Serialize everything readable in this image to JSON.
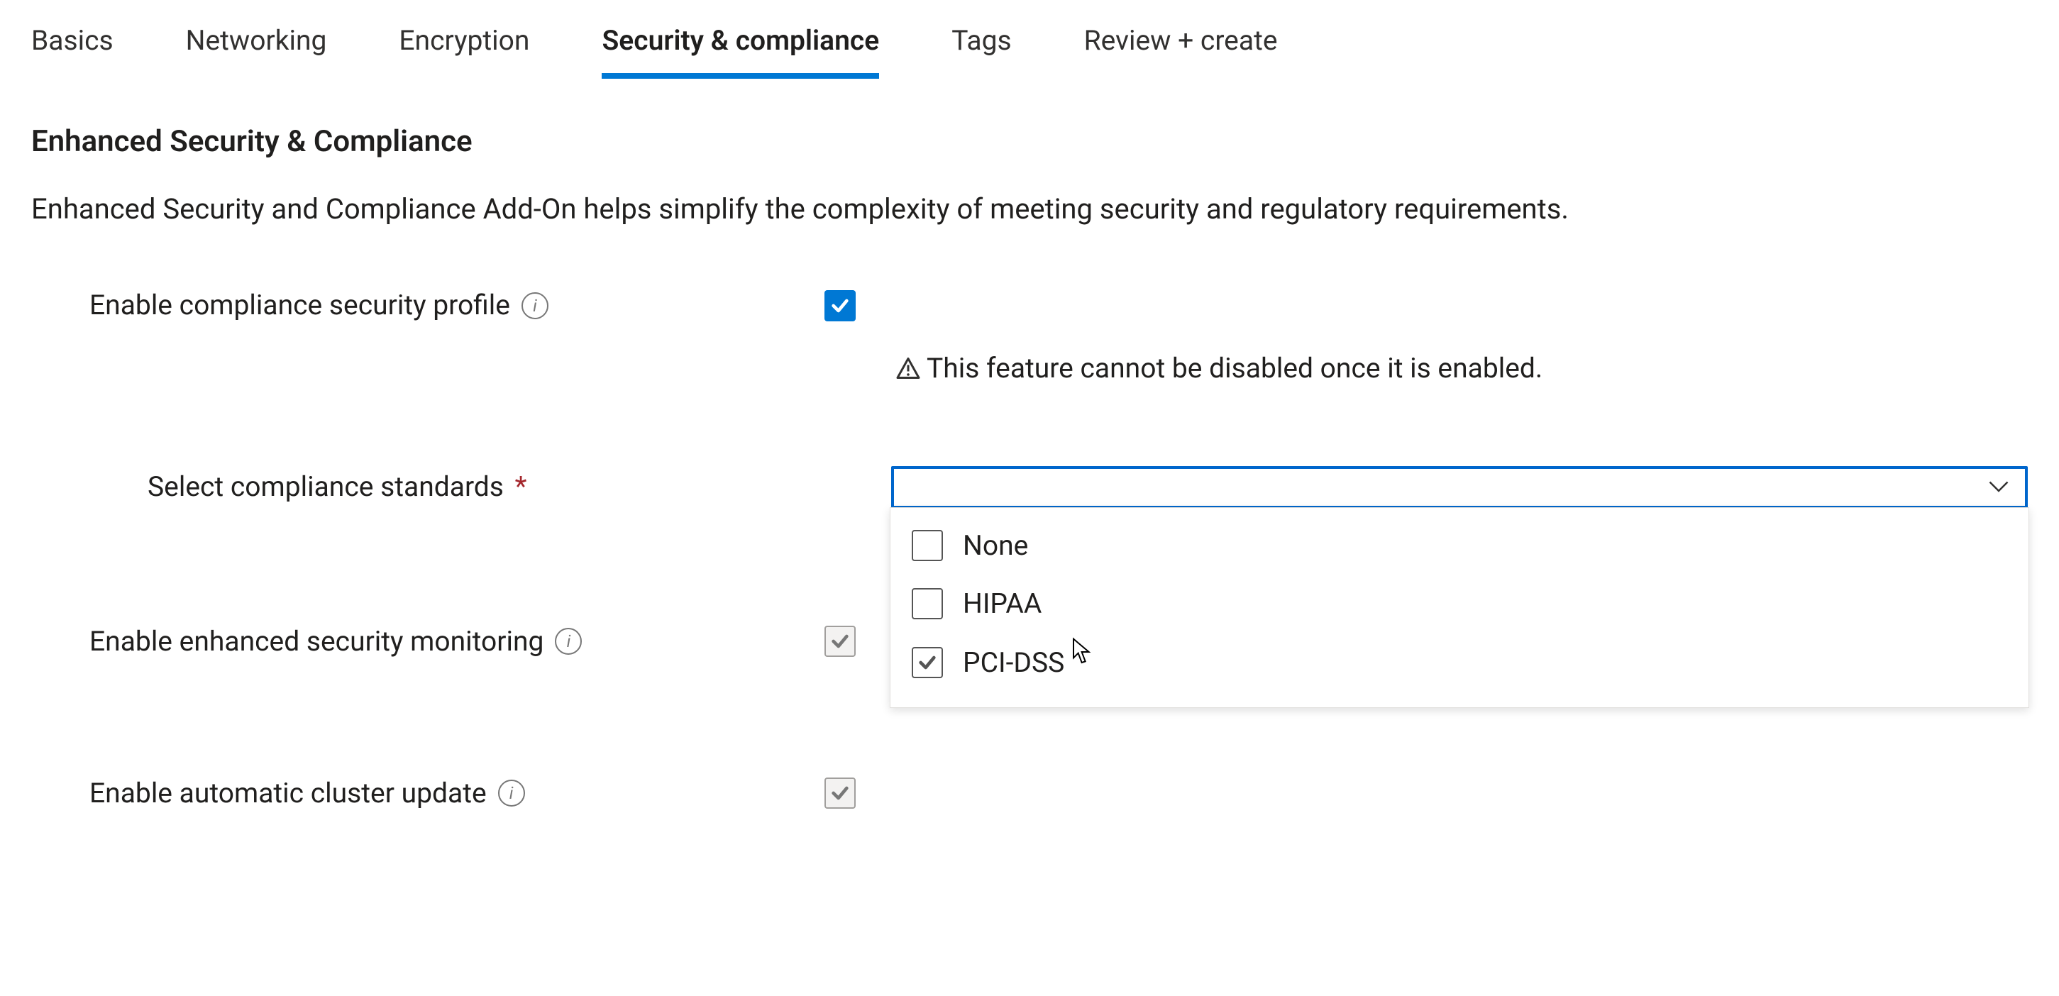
{
  "tabs": [
    {
      "label": "Basics",
      "active": false
    },
    {
      "label": "Networking",
      "active": false
    },
    {
      "label": "Encryption",
      "active": false
    },
    {
      "label": "Security & compliance",
      "active": true
    },
    {
      "label": "Tags",
      "active": false
    },
    {
      "label": "Review + create",
      "active": false
    }
  ],
  "section": {
    "title": "Enhanced Security & Compliance",
    "description": "Enhanced Security and Compliance Add-On helps simplify the complexity of meeting security and regulatory requirements."
  },
  "fields": {
    "enable_profile": {
      "label": "Enable compliance security profile",
      "checked": true,
      "warning": "This feature cannot be disabled once it is enabled."
    },
    "standards": {
      "label": "Select compliance standards",
      "required": true,
      "value": "",
      "options": [
        {
          "label": "None",
          "checked": false
        },
        {
          "label": "HIPAA",
          "checked": false
        },
        {
          "label": "PCI-DSS",
          "checked": true
        }
      ]
    },
    "enhanced_monitoring": {
      "label": "Enable enhanced security monitoring",
      "checked": true,
      "disabled": true
    },
    "auto_update": {
      "label": "Enable automatic cluster update",
      "checked": true,
      "disabled": true
    }
  },
  "colors": {
    "accent": "#0078d4",
    "focus_border": "#0066cc",
    "text": "#201f1e",
    "required": "#a4262c"
  }
}
